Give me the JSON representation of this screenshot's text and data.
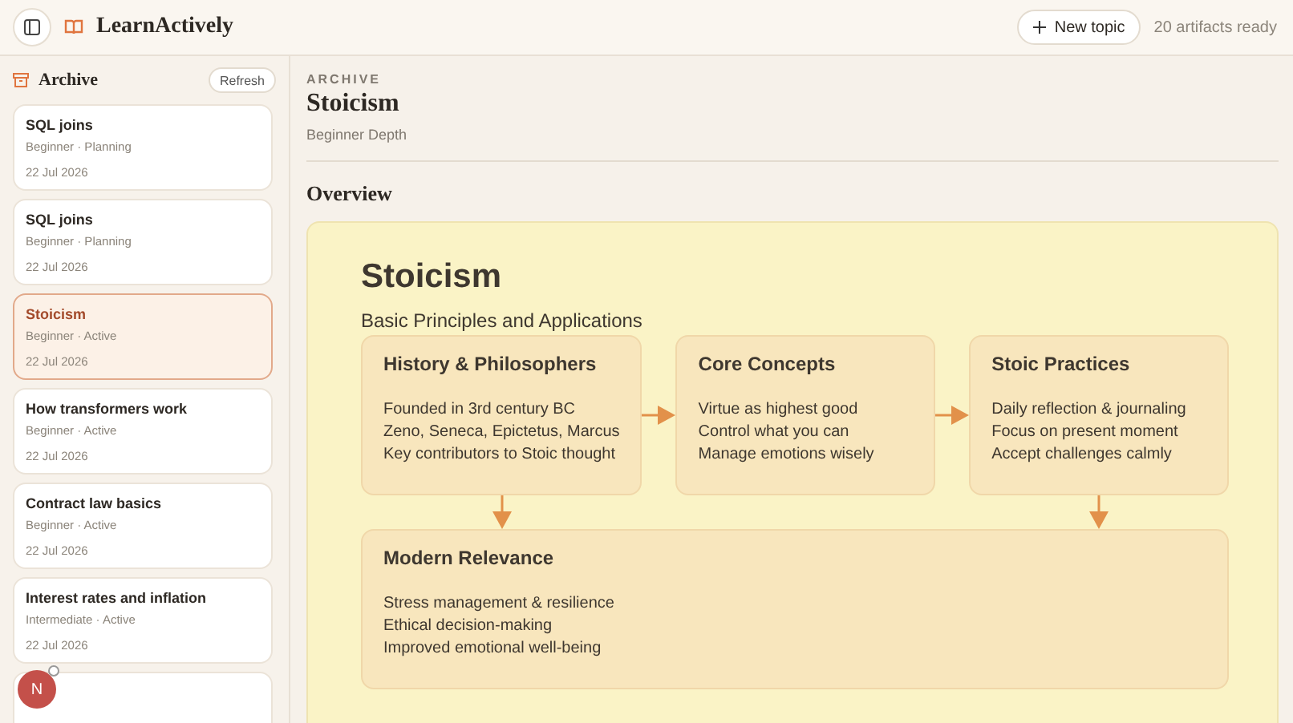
{
  "header": {
    "app_name": "LearnActively",
    "new_topic": "New topic",
    "status": "20 artifacts ready"
  },
  "sidebar": {
    "title": "Archive",
    "refresh": "Refresh",
    "items": [
      {
        "title": "SQL joins",
        "meta": "Beginner · Planning",
        "date": "22 Jul 2026",
        "selected": false
      },
      {
        "title": "SQL joins",
        "meta": "Beginner · Planning",
        "date": "22 Jul 2026",
        "selected": false
      },
      {
        "title": "Stoicism",
        "meta": "Beginner · Active",
        "date": "22 Jul 2026",
        "selected": true
      },
      {
        "title": "How transformers work",
        "meta": "Beginner · Active",
        "date": "22 Jul 2026",
        "selected": false
      },
      {
        "title": "Contract law basics",
        "meta": "Beginner · Active",
        "date": "22 Jul 2026",
        "selected": false
      },
      {
        "title": "Interest rates and inflation",
        "meta": "Intermediate · Active",
        "date": "22 Jul 2026",
        "selected": false
      }
    ],
    "avatar": "N"
  },
  "main": {
    "eyebrow": "ARCHIVE",
    "title": "Stoicism",
    "subtitle": "Beginner Depth",
    "section": "Overview",
    "diagram": {
      "title": "Stoicism",
      "subtitle": "Basic Principles and Applications",
      "boxes": [
        {
          "title": "History & Philosophers",
          "lines": [
            "Founded in 3rd century BC",
            "Zeno, Seneca, Epictetus, Marcus",
            "Key contributors to Stoic thought"
          ]
        },
        {
          "title": "Core Concepts",
          "lines": [
            "Virtue as highest good",
            "Control what you can",
            "Manage emotions wisely"
          ]
        },
        {
          "title": "Stoic Practices",
          "lines": [
            "Daily reflection & journaling",
            "Focus on present moment",
            "Accept challenges calmly"
          ]
        }
      ],
      "bottom": {
        "title": "Modern Relevance",
        "lines": [
          "Stress management & resilience",
          "Ethical decision-making",
          "Improved emotional well-being"
        ]
      }
    }
  }
}
